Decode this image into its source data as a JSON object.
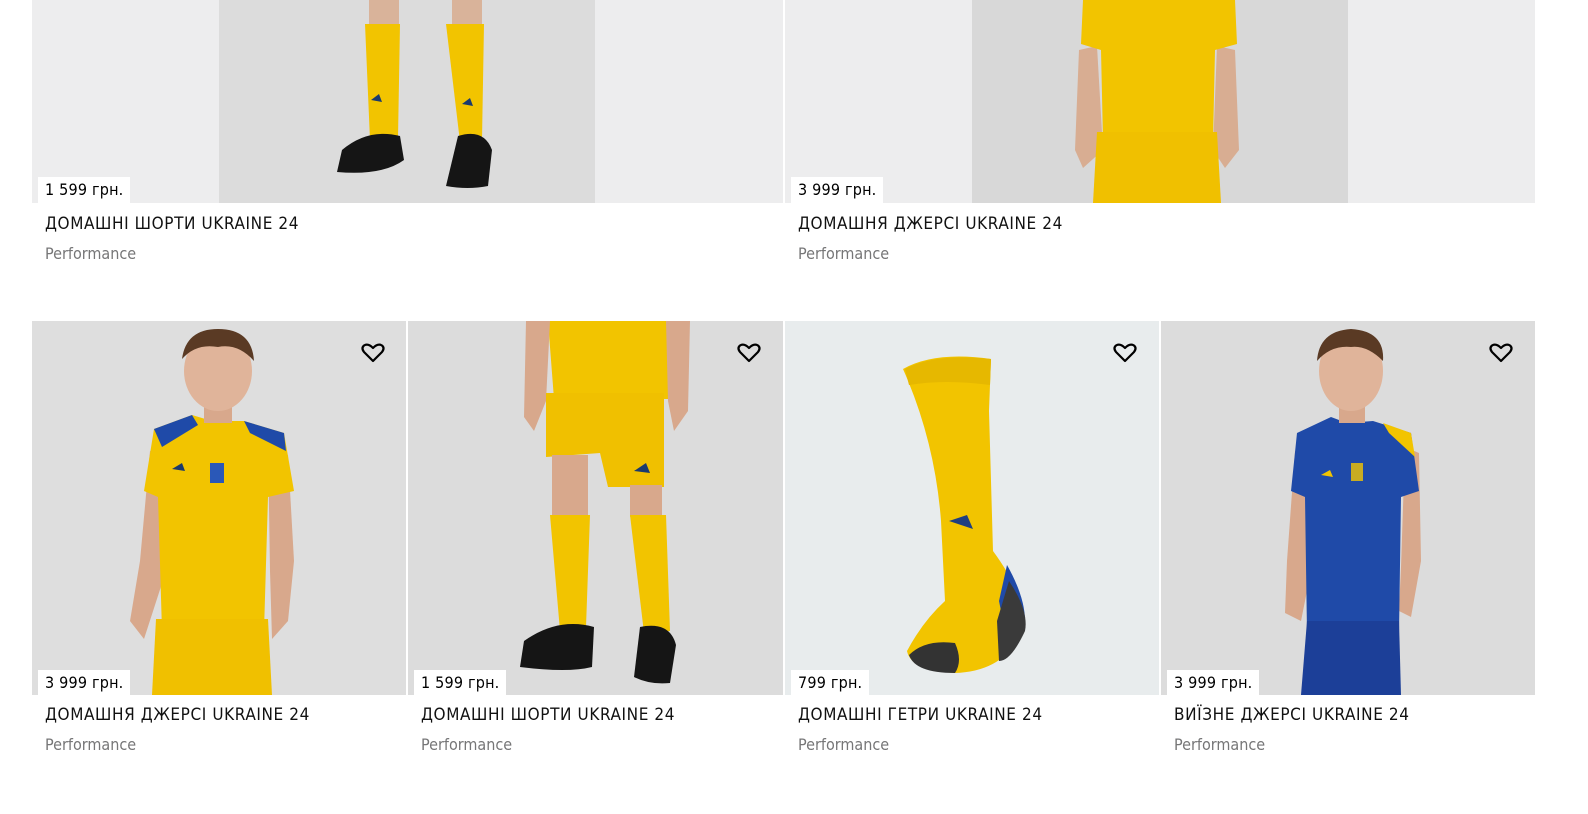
{
  "products_top": [
    {
      "price": "1 599 грн.",
      "title": "ДОМАШНІ ШОРТИ UKRAINE 24",
      "brand": "Performance",
      "image": "shorts-socks-legs"
    },
    {
      "price": "3 999 грн.",
      "title": "ДОМАШНЯ ДЖЕРСІ UKRAINE 24",
      "brand": "Performance",
      "image": "jersey-torso"
    }
  ],
  "products_bottom": [
    {
      "price": "3 999 грн.",
      "title": "ДОМАШНЯ ДЖЕРСІ UKRAINE 24",
      "brand": "Performance",
      "image": "model-yellow-jersey",
      "wishlist_icon": "heart-icon"
    },
    {
      "price": "1 599 грн.",
      "title": "ДОМАШНІ ШОРТИ UKRAINE 24",
      "brand": "Performance",
      "image": "model-yellow-shorts",
      "wishlist_icon": "heart-icon"
    },
    {
      "price": "799 грн.",
      "title": "ДОМАШНІ ГЕТРИ UKRAINE 24",
      "brand": "Performance",
      "image": "yellow-sock",
      "wishlist_icon": "heart-icon"
    },
    {
      "price": "3 999 грн.",
      "title": "ВИЇЗНЕ ДЖЕРСІ UKRAINE 24",
      "brand": "Performance",
      "image": "model-blue-jersey",
      "wishlist_icon": "heart-icon"
    }
  ],
  "colors": {
    "kit_yellow": "#f2c400",
    "kit_blue": "#1f4aa8",
    "photo_bg": "#e3e4e5",
    "brand_grey": "#767677"
  }
}
